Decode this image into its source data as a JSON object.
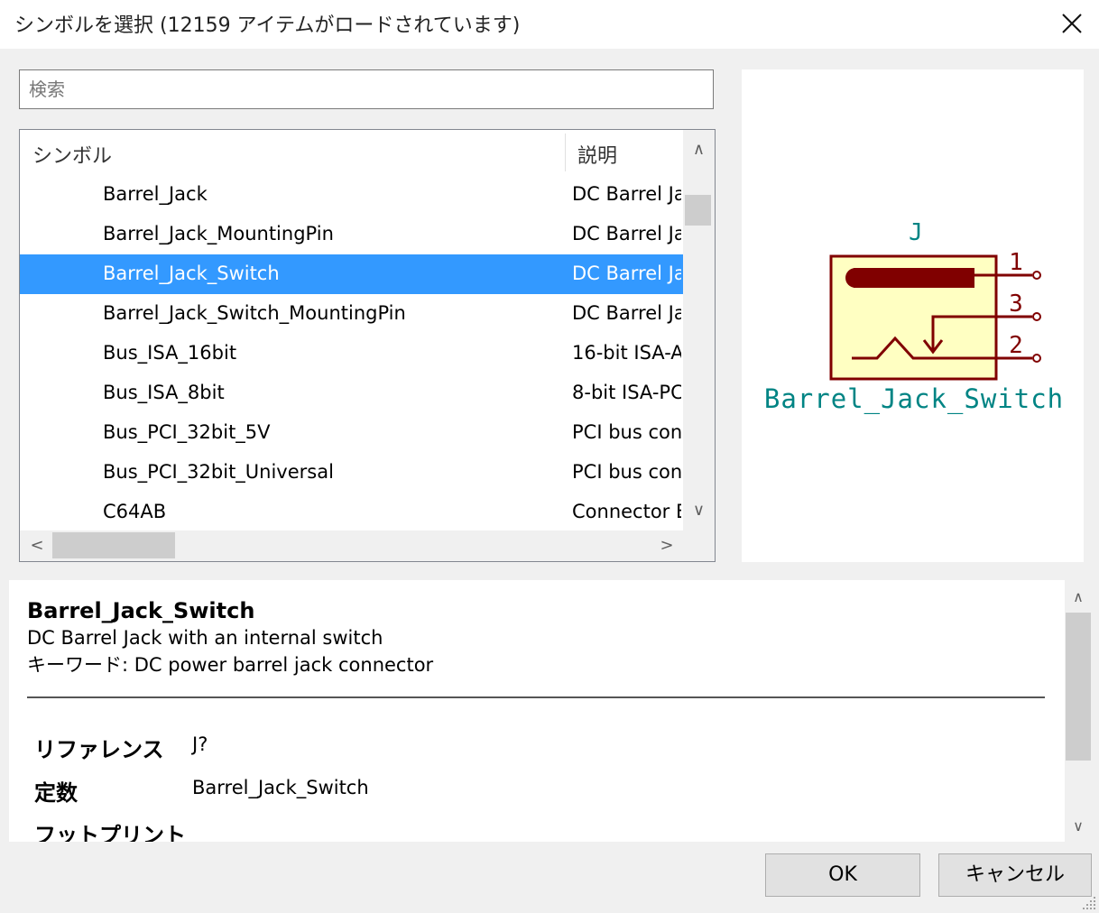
{
  "dialog": {
    "title": "シンボルを選択 (12159 アイテムがロードされています)"
  },
  "search": {
    "placeholder": "検索",
    "value": ""
  },
  "list": {
    "col_symbol": "シンボル",
    "col_desc": "説明",
    "rows": [
      {
        "name": "Barrel_Jack",
        "desc": "DC Barrel Ja"
      },
      {
        "name": "Barrel_Jack_MountingPin",
        "desc": "DC Barrel Ja"
      },
      {
        "name": "Barrel_Jack_Switch",
        "desc": "DC Barrel Ja",
        "selected": true
      },
      {
        "name": "Barrel_Jack_Switch_MountingPin",
        "desc": "DC Barrel Ja"
      },
      {
        "name": "Bus_ISA_16bit",
        "desc": "16-bit ISA-A"
      },
      {
        "name": "Bus_ISA_8bit",
        "desc": "8-bit ISA-PC"
      },
      {
        "name": "Bus_PCI_32bit_5V",
        "desc": "PCI bus con"
      },
      {
        "name": "Bus_PCI_32bit_Universal",
        "desc": "PCI bus con"
      },
      {
        "name": "C64AB",
        "desc": "Connector E"
      }
    ]
  },
  "preview": {
    "reference": "J",
    "value": "Barrel_Jack_Switch",
    "pins": [
      "1",
      "3",
      "2"
    ],
    "colors": {
      "outline": "#800000",
      "fill": "#ffffc2",
      "text": "#008484"
    }
  },
  "details": {
    "name": "Barrel_Jack_Switch",
    "description": "DC Barrel Jack with an internal switch",
    "keywords": "キーワード: DC power barrel jack connector",
    "fields": [
      {
        "label": "リファレンス",
        "value": "J?"
      },
      {
        "label": "定数",
        "value": "Barrel_Jack_Switch"
      },
      {
        "label": "フットプリント",
        "value": ""
      }
    ]
  },
  "buttons": {
    "ok": "OK",
    "cancel": "キャンセル"
  },
  "colors": {
    "selection": "#3399ff"
  }
}
